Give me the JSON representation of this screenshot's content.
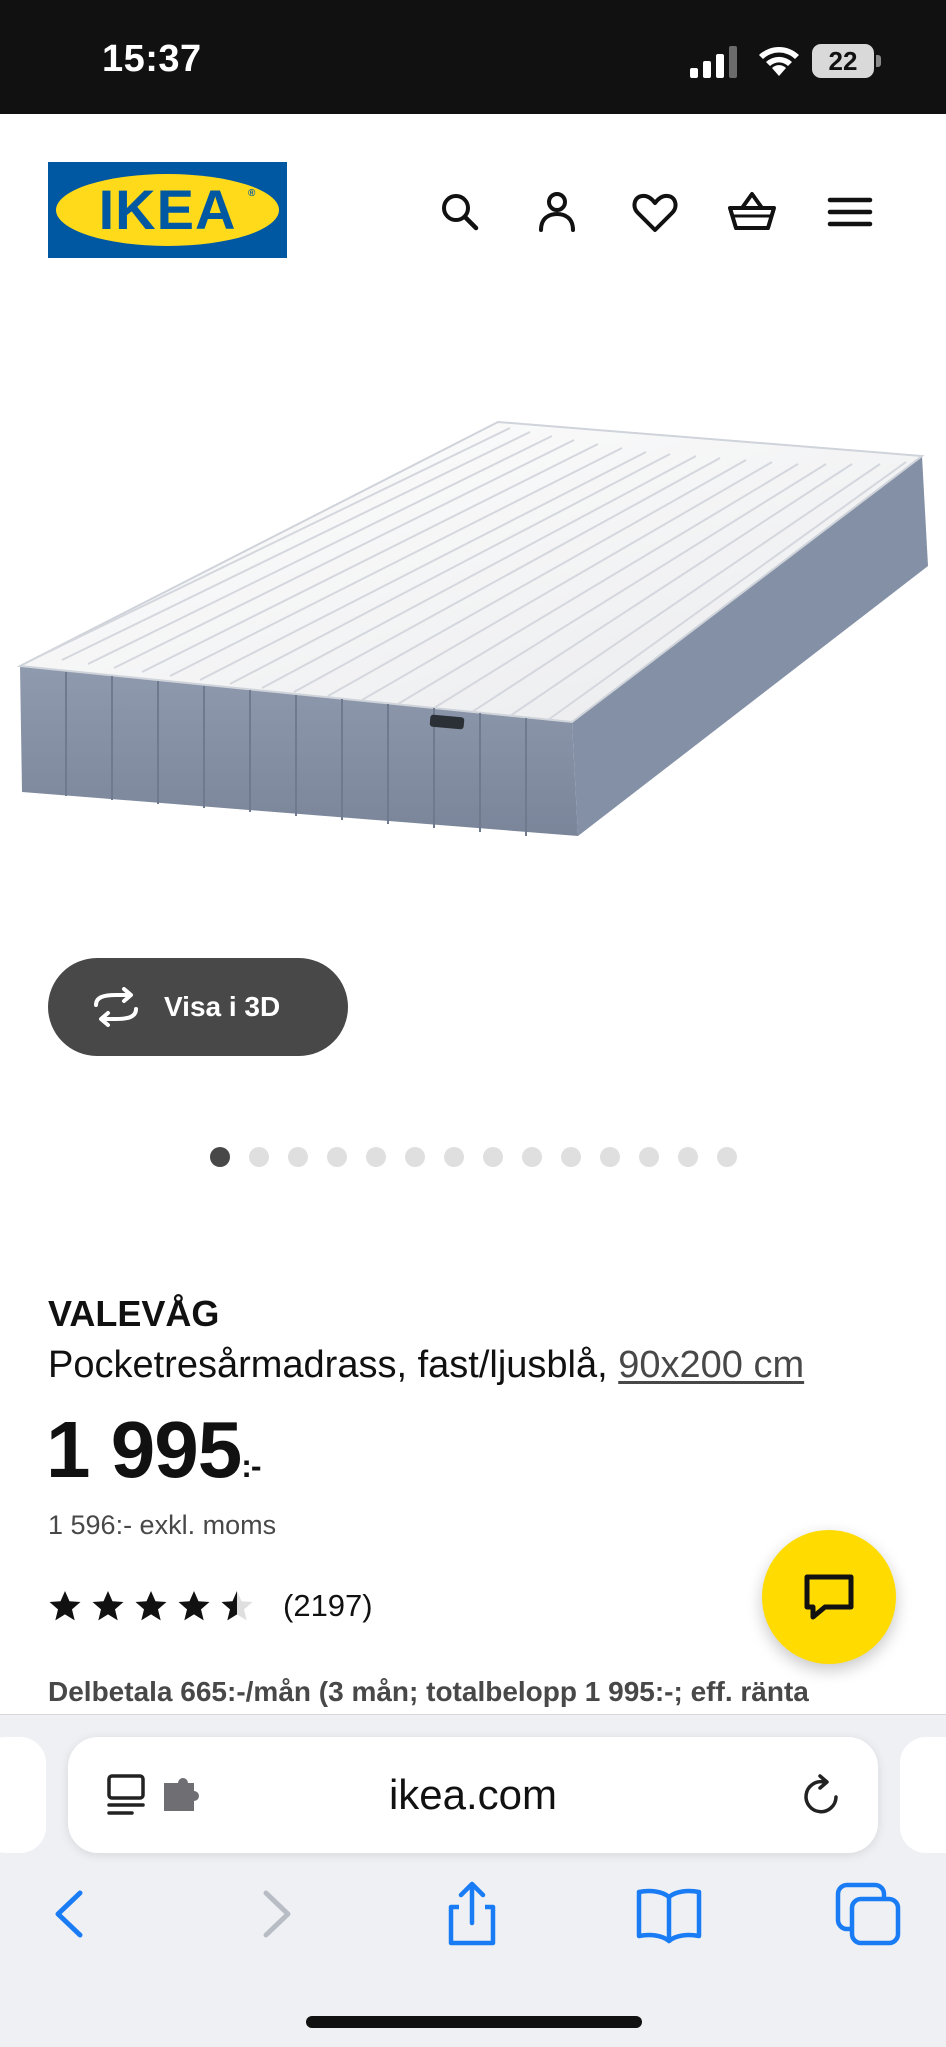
{
  "status_bar": {
    "time": "15:37",
    "battery": "22"
  },
  "header": {
    "logo_text": "IKEA",
    "logo_registered": "®",
    "icons": [
      "search-icon",
      "account-icon",
      "heart-icon",
      "basket-icon",
      "menu-icon"
    ],
    "brand_blue": "#0058a3",
    "brand_yellow": "#ffda1a"
  },
  "gallery": {
    "view_3d_label": "Visa i 3D",
    "dot_count": 14,
    "active_dot": 0
  },
  "product": {
    "name": "VALEVÅG",
    "description": "Pocketresårmadrass, fast/ljusblå, ",
    "size": "90x200 cm",
    "price": "1 995",
    "price_suffix": ":-",
    "price_exkl": "1 596:- exkl. moms",
    "rating": 4.5,
    "rating_count": "(2197)",
    "installment": "Delbetala 665:-/mån (3 mån; totalbelopp 1 995:-; eff. ränta"
  },
  "chat": {
    "icon": "chat-icon",
    "color": "#ffdb00"
  },
  "browser": {
    "url": "ikea.com",
    "icons": [
      "reader-icon",
      "extension-icon",
      "reload-icon",
      "back-icon",
      "forward-icon",
      "share-icon",
      "bookmarks-icon",
      "tabs-icon"
    ],
    "accent": "#1a7cf5"
  }
}
